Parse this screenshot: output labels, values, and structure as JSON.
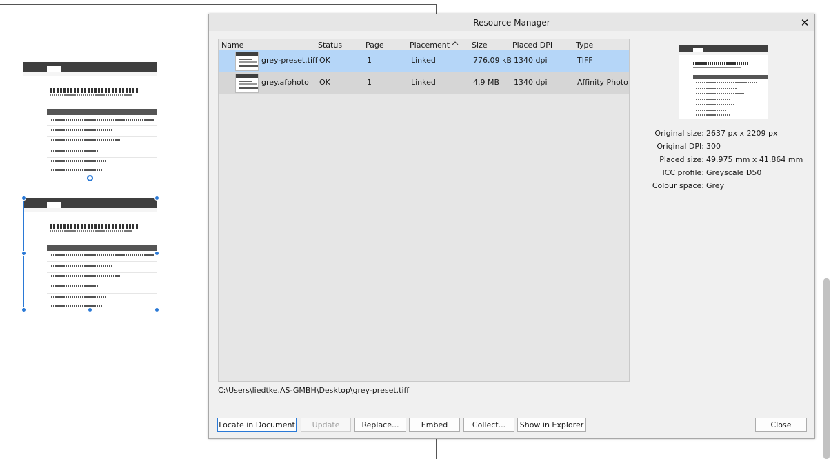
{
  "dialog": {
    "title": "Resource Manager",
    "close_glyph": "✕"
  },
  "columns": [
    "Name",
    "Status",
    "Page",
    "Placement",
    "Size",
    "Placed DPI",
    "Type"
  ],
  "sort_glyph": "^",
  "rows": [
    {
      "name": "grey-preset.tiff",
      "status": "OK",
      "page": "1",
      "placement": "Linked",
      "size": "776.09 kB",
      "dpi": "1340 dpi",
      "type": "TIFF",
      "selected": true
    },
    {
      "name": "grey.afphoto",
      "status": "OK",
      "page": "1",
      "placement": "Linked",
      "size": "4.9 MB",
      "dpi": "1340 dpi",
      "type": "Affinity Photo",
      "selected": false
    }
  ],
  "path": "C:\\Users\\liedtke.AS-GMBH\\Desktop\\grey-preset.tiff",
  "properties": [
    {
      "label": "Original size:",
      "value": "2637 px x 2209 px"
    },
    {
      "label": "Original DPI:",
      "value": "300"
    },
    {
      "label": "Placed size:",
      "value": "49.975 mm x 41.864 mm"
    },
    {
      "label": "ICC profile:",
      "value": "Greyscale D50"
    },
    {
      "label": "Colour space:",
      "value": "Grey"
    }
  ],
  "buttons": {
    "locate": "Locate in Document",
    "update": "Update",
    "replace": "Replace...",
    "embed": "Embed",
    "collect": "Collect...",
    "explorer": "Show in Explorer",
    "close": "Close"
  },
  "colors": {
    "selected_row": "#b5d6f8",
    "selection_frame": "#2a79d6",
    "dialog_bg": "#f0f0f0"
  }
}
